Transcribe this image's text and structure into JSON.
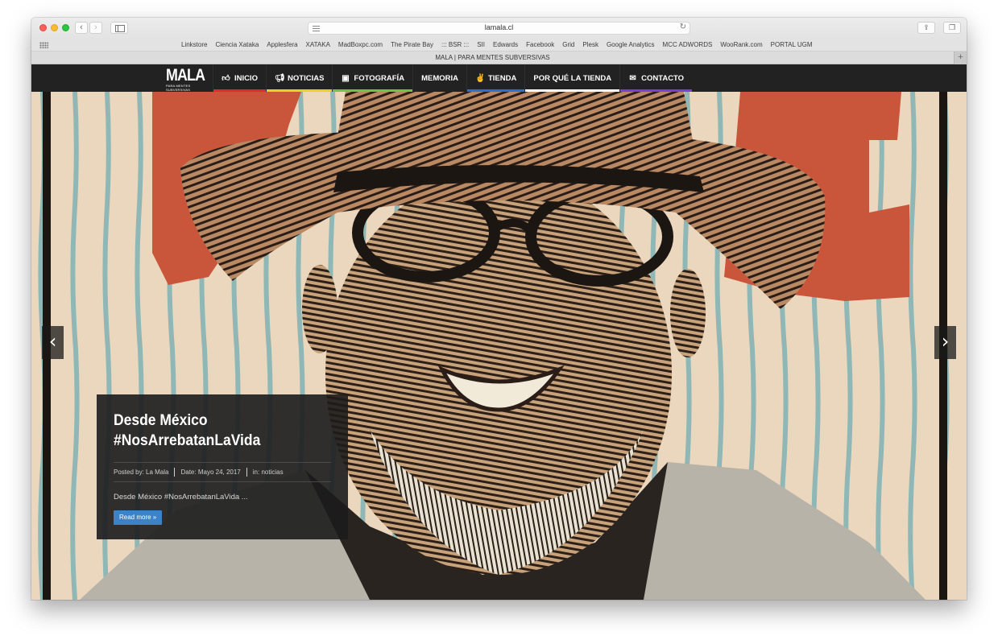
{
  "browser": {
    "url": "lamala.cl",
    "tab_title": "MALA | PARA MENTES SUBVERSIVAS",
    "back_label": "‹",
    "forward_label": "›",
    "reload_icon": "reload-icon",
    "bookmarks": [
      "Linkstore",
      "Ciencia Xataka",
      "Applesfera",
      "XATAKA",
      "MadBoxpc.com",
      "The Pirate Bay",
      "::: BSR :::",
      "SII",
      "Edwards",
      "Facebook",
      "Grid",
      "Plesk",
      "Google Analytics",
      "MCC ADWORDS",
      "WooRank.com",
      "PORTAL UGM"
    ],
    "new_tab_label": "+"
  },
  "site": {
    "logo_text": "MALA",
    "logo_subtext": "PARA MENTES SUBVERSIVAS",
    "menu": [
      {
        "label": "INICIO",
        "icon": "thumbs-up-icon",
        "color": "#e02b2b"
      },
      {
        "label": "NOTICIAS",
        "icon": "megaphone-icon",
        "color": "#e8d21d"
      },
      {
        "label": "FOTOGRAFÍA",
        "icon": "photo-icon",
        "color": "#6cc644"
      },
      {
        "label": "MEMORIA",
        "icon": "",
        "color": "#222222"
      },
      {
        "label": "TIENDA",
        "icon": "hand-icon",
        "color": "#2d6fcf"
      },
      {
        "label": "POR QUÉ LA TIENDA",
        "icon": "",
        "color": "#ffffff"
      },
      {
        "label": "CONTACTO",
        "icon": "envelope-icon",
        "color": "#7b3fd6"
      }
    ]
  },
  "slider": {
    "prev_label": "‹",
    "next_label": "›",
    "caption": {
      "title": "Desde México #NosArrebatanLaVida",
      "posted_by": "Posted by: La Mala",
      "date": "Date: Mayo 24, 2017",
      "category": "in: noticias",
      "excerpt": "Desde México #NosArrebatanLaVida ...",
      "read_more": "Read more »",
      "button_color": "#3b83c6"
    }
  }
}
